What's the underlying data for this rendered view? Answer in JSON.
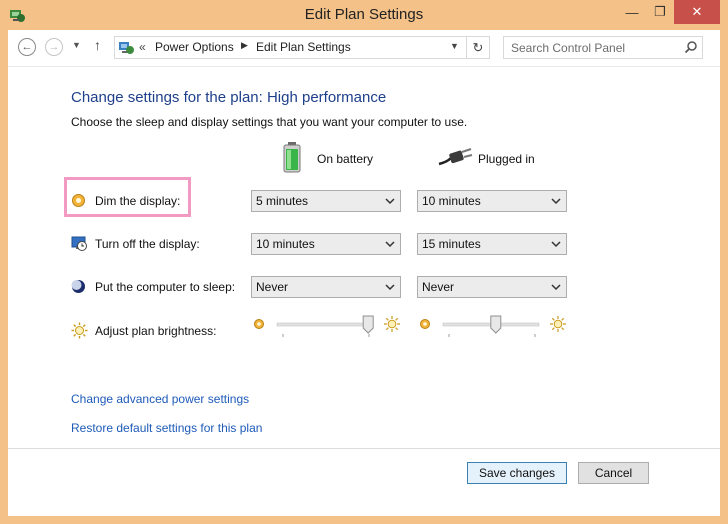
{
  "window": {
    "title": "Edit Plan Settings",
    "minimize_glyph": "—",
    "maximize_glyph": "❐",
    "close_glyph": "✕"
  },
  "addressbar": {
    "back_glyph": "←",
    "forward_glyph": "→",
    "recent_glyph": "▼",
    "up_glyph": "↑",
    "overflow_glyph": "«",
    "breadcrumb": [
      "Power Options",
      "Edit Plan Settings"
    ],
    "separator_glyph": "▶",
    "dropdown_glyph": "▼",
    "refresh_glyph": "↻",
    "search_placeholder": "Search Control Panel"
  },
  "main": {
    "heading": "Change settings for the plan: High performance",
    "subheading": "Choose the sleep and display settings that you want your computer to use.",
    "columns": [
      "On battery",
      "Plugged in"
    ],
    "rows": [
      {
        "label": "Dim the display:",
        "icon": "dim-display-icon",
        "battery": "5 minutes",
        "plugged": "10 minutes"
      },
      {
        "label": "Turn off the display:",
        "icon": "monitor-clock-icon",
        "battery": "10 minutes",
        "plugged": "15 minutes"
      },
      {
        "label": "Put the computer to sleep:",
        "icon": "moon-icon",
        "battery": "Never",
        "plugged": "Never"
      }
    ],
    "brightness": {
      "label": "Adjust plan brightness:",
      "battery_level": 0.95,
      "plugged_level": 0.55
    }
  },
  "links": {
    "advanced": "Change advanced power settings",
    "restore": "Restore default settings for this plan"
  },
  "buttons": {
    "save": "Save changes",
    "cancel": "Cancel"
  },
  "colors": {
    "frame": "#f4c188",
    "heading": "#1e3f8a",
    "link": "#1e5bb8",
    "close": "#c7504a",
    "highlight": "#f29ac1"
  }
}
